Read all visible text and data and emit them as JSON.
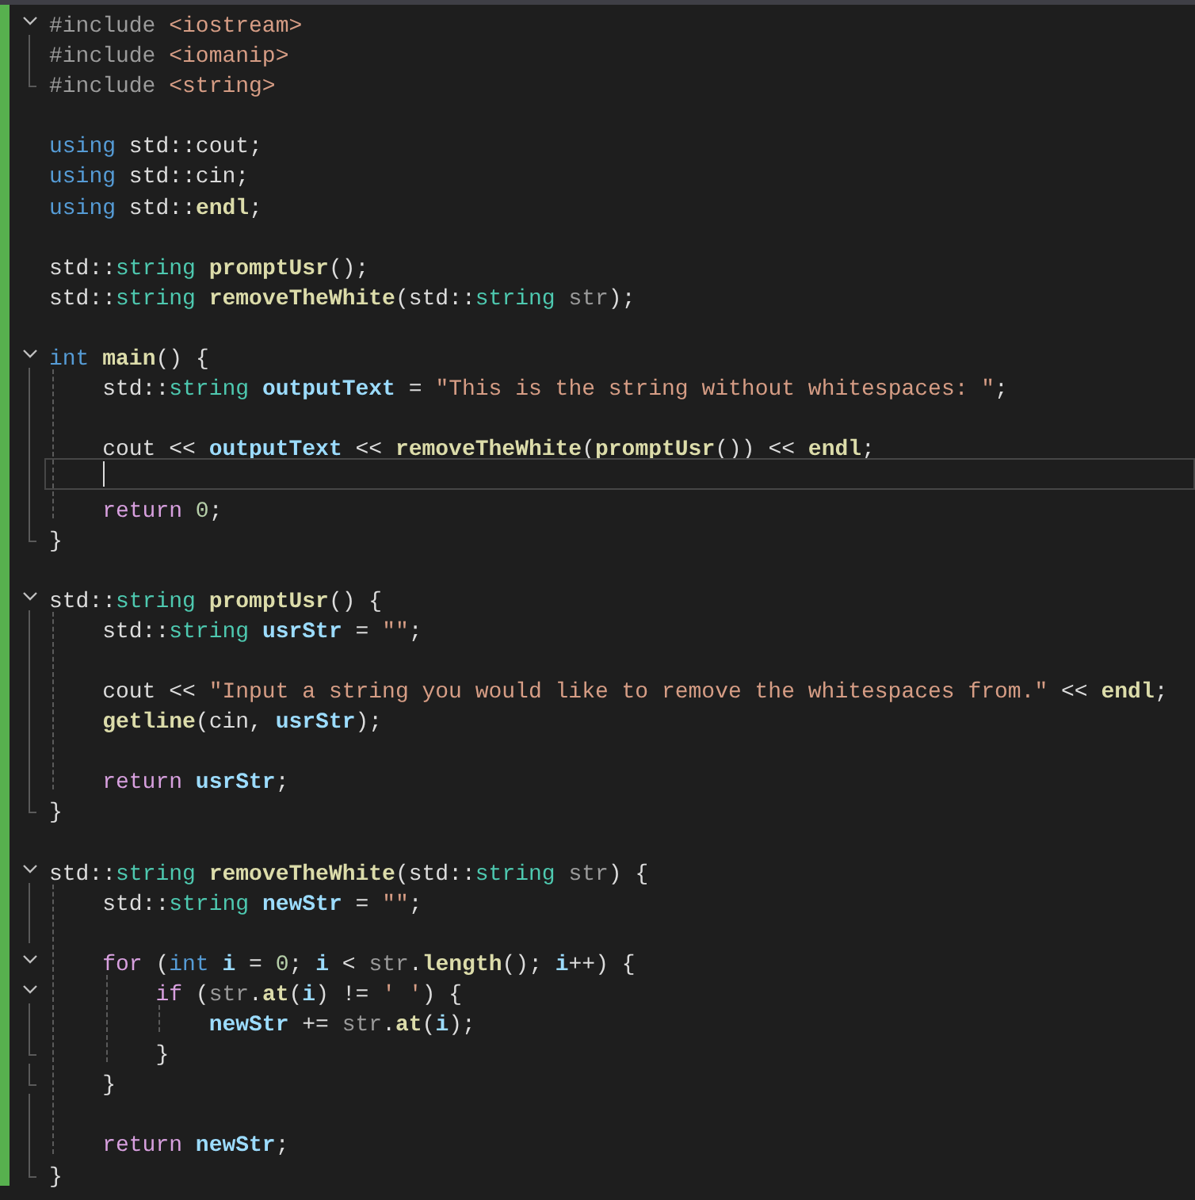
{
  "editor": {
    "lines": [
      {
        "kind": "code",
        "expanded": true,
        "tokens": [
          {
            "kind": "pre",
            "text": "#include"
          },
          {
            "kind": "str",
            "text": " <iostream>"
          }
        ]
      },
      {
        "kind": "code",
        "tokens": [
          {
            "kind": "pre",
            "text": "#include"
          },
          {
            "kind": "str",
            "text": " <iomanip>"
          }
        ]
      },
      {
        "kind": "code",
        "tokens": [
          {
            "kind": "pre",
            "text": "#include"
          },
          {
            "kind": "str",
            "text": " <string>"
          }
        ]
      },
      {
        "kind": "blank"
      },
      {
        "kind": "code",
        "tokens": [
          {
            "kind": "kw",
            "text": "using"
          },
          {
            "kind": "op",
            "text": " std::cout;"
          }
        ]
      },
      {
        "kind": "code",
        "tokens": [
          {
            "kind": "kw",
            "text": "using"
          },
          {
            "kind": "op",
            "text": " std::cin;"
          }
        ]
      },
      {
        "kind": "code",
        "tokens": [
          {
            "kind": "kw",
            "text": "using"
          },
          {
            "kind": "op",
            "text": " std::"
          },
          {
            "kind": "fn",
            "text": "endl"
          },
          {
            "kind": "op",
            "text": ";"
          }
        ]
      },
      {
        "kind": "blank"
      },
      {
        "kind": "code",
        "tokens": [
          {
            "kind": "op",
            "text": "std::"
          },
          {
            "kind": "type",
            "text": "string"
          },
          {
            "kind": "fn",
            "text": " promptUsr"
          },
          {
            "kind": "op",
            "text": "();"
          }
        ]
      },
      {
        "kind": "code",
        "tokens": [
          {
            "kind": "op",
            "text": "std::"
          },
          {
            "kind": "type",
            "text": "string"
          },
          {
            "kind": "fn",
            "text": " removeTheWhite"
          },
          {
            "kind": "op",
            "text": "(std::"
          },
          {
            "kind": "type",
            "text": "string"
          },
          {
            "kind": "param",
            "text": " str"
          },
          {
            "kind": "op",
            "text": ");"
          }
        ]
      },
      {
        "kind": "blank"
      },
      {
        "kind": "code",
        "expanded": true,
        "tokens": [
          {
            "kind": "kw",
            "text": "int"
          },
          {
            "kind": "fn",
            "text": " main"
          },
          {
            "kind": "op",
            "text": "() {"
          }
        ]
      },
      {
        "kind": "code",
        "tokens": [
          {
            "kind": "op",
            "text": "    std::"
          },
          {
            "kind": "type",
            "text": "string"
          },
          {
            "kind": "var",
            "text": " outputText"
          },
          {
            "kind": "op",
            "text": " = "
          },
          {
            "kind": "str",
            "text": "\"This is the string without whitespaces: \""
          },
          {
            "kind": "op",
            "text": ";"
          }
        ]
      },
      {
        "kind": "blank"
      },
      {
        "kind": "code",
        "tokens": [
          {
            "kind": "op",
            "text": "    cout << "
          },
          {
            "kind": "var",
            "text": "outputText"
          },
          {
            "kind": "op",
            "text": " << "
          },
          {
            "kind": "fn",
            "text": "removeTheWhite"
          },
          {
            "kind": "op",
            "text": "("
          },
          {
            "kind": "fn",
            "text": "promptUsr"
          },
          {
            "kind": "op",
            "text": "()) << "
          },
          {
            "kind": "fn",
            "text": "endl"
          },
          {
            "kind": "op",
            "text": ";"
          }
        ]
      },
      {
        "kind": "blank",
        "current": true
      },
      {
        "kind": "code",
        "tokens": [
          {
            "kind": "ctl",
            "text": "    return"
          },
          {
            "kind": "num",
            "text": " 0"
          },
          {
            "kind": "op",
            "text": ";"
          }
        ]
      },
      {
        "kind": "code",
        "tokens": [
          {
            "kind": "op",
            "text": "}"
          }
        ]
      },
      {
        "kind": "blank"
      },
      {
        "kind": "code",
        "expanded": true,
        "tokens": [
          {
            "kind": "op",
            "text": "std::"
          },
          {
            "kind": "type",
            "text": "string"
          },
          {
            "kind": "fn",
            "text": " promptUsr"
          },
          {
            "kind": "op",
            "text": "() {"
          }
        ]
      },
      {
        "kind": "code",
        "tokens": [
          {
            "kind": "op",
            "text": "    std::"
          },
          {
            "kind": "type",
            "text": "string"
          },
          {
            "kind": "var",
            "text": " usrStr"
          },
          {
            "kind": "op",
            "text": " = "
          },
          {
            "kind": "str",
            "text": "\"\""
          },
          {
            "kind": "op",
            "text": ";"
          }
        ]
      },
      {
        "kind": "blank"
      },
      {
        "kind": "code",
        "tokens": [
          {
            "kind": "op",
            "text": "    cout << "
          },
          {
            "kind": "str",
            "text": "\"Input a string you would like to remove the whitespaces from.\""
          },
          {
            "kind": "op",
            "text": " << "
          },
          {
            "kind": "fn",
            "text": "endl"
          },
          {
            "kind": "op",
            "text": ";"
          }
        ]
      },
      {
        "kind": "code",
        "tokens": [
          {
            "kind": "fn",
            "text": "    getline"
          },
          {
            "kind": "op",
            "text": "(cin, "
          },
          {
            "kind": "var",
            "text": "usrStr"
          },
          {
            "kind": "op",
            "text": ");"
          }
        ]
      },
      {
        "kind": "blank"
      },
      {
        "kind": "code",
        "tokens": [
          {
            "kind": "ctl",
            "text": "    return"
          },
          {
            "kind": "var",
            "text": " usrStr"
          },
          {
            "kind": "op",
            "text": ";"
          }
        ]
      },
      {
        "kind": "code",
        "tokens": [
          {
            "kind": "op",
            "text": "}"
          }
        ]
      },
      {
        "kind": "blank"
      },
      {
        "kind": "code",
        "expanded": true,
        "tokens": [
          {
            "kind": "op",
            "text": "std::"
          },
          {
            "kind": "type",
            "text": "string"
          },
          {
            "kind": "fn",
            "text": " removeTheWhite"
          },
          {
            "kind": "op",
            "text": "(std::"
          },
          {
            "kind": "type",
            "text": "string"
          },
          {
            "kind": "param",
            "text": " str"
          },
          {
            "kind": "op",
            "text": ") {"
          }
        ]
      },
      {
        "kind": "code",
        "tokens": [
          {
            "kind": "op",
            "text": "    std::"
          },
          {
            "kind": "type",
            "text": "string"
          },
          {
            "kind": "var",
            "text": " newStr"
          },
          {
            "kind": "op",
            "text": " = "
          },
          {
            "kind": "str",
            "text": "\"\""
          },
          {
            "kind": "op",
            "text": ";"
          }
        ]
      },
      {
        "kind": "blank"
      },
      {
        "kind": "code",
        "expanded": true,
        "tokens": [
          {
            "kind": "ctl",
            "text": "    for"
          },
          {
            "kind": "op",
            "text": " ("
          },
          {
            "kind": "kw",
            "text": "int"
          },
          {
            "kind": "var",
            "text": " i"
          },
          {
            "kind": "op",
            "text": " = "
          },
          {
            "kind": "num",
            "text": "0"
          },
          {
            "kind": "op",
            "text": "; "
          },
          {
            "kind": "var",
            "text": "i"
          },
          {
            "kind": "op",
            "text": " < "
          },
          {
            "kind": "param",
            "text": "str"
          },
          {
            "kind": "op",
            "text": "."
          },
          {
            "kind": "fn",
            "text": "length"
          },
          {
            "kind": "op",
            "text": "(); "
          },
          {
            "kind": "var",
            "text": "i"
          },
          {
            "kind": "op",
            "text": "++) {"
          }
        ]
      },
      {
        "kind": "code",
        "expanded": true,
        "tokens": [
          {
            "kind": "ctl",
            "text": "        if"
          },
          {
            "kind": "op",
            "text": " ("
          },
          {
            "kind": "param",
            "text": "str"
          },
          {
            "kind": "op",
            "text": "."
          },
          {
            "kind": "fn",
            "text": "at"
          },
          {
            "kind": "op",
            "text": "("
          },
          {
            "kind": "var",
            "text": "i"
          },
          {
            "kind": "op",
            "text": ") != "
          },
          {
            "kind": "str",
            "text": "' '"
          },
          {
            "kind": "op",
            "text": ") {"
          }
        ]
      },
      {
        "kind": "code",
        "tokens": [
          {
            "kind": "var",
            "text": "            newStr"
          },
          {
            "kind": "op",
            "text": " += "
          },
          {
            "kind": "param",
            "text": "str"
          },
          {
            "kind": "op",
            "text": "."
          },
          {
            "kind": "fn",
            "text": "at"
          },
          {
            "kind": "op",
            "text": "("
          },
          {
            "kind": "var",
            "text": "i"
          },
          {
            "kind": "op",
            "text": ");"
          }
        ]
      },
      {
        "kind": "code",
        "tokens": [
          {
            "kind": "op",
            "text": "        }"
          }
        ]
      },
      {
        "kind": "code",
        "tokens": [
          {
            "kind": "op",
            "text": "    }"
          }
        ]
      },
      {
        "kind": "blank"
      },
      {
        "kind": "code",
        "tokens": [
          {
            "kind": "ctl",
            "text": "    return"
          },
          {
            "kind": "var",
            "text": " newStr"
          },
          {
            "kind": "op",
            "text": ";"
          }
        ]
      },
      {
        "kind": "code",
        "tokens": [
          {
            "kind": "op",
            "text": "}"
          }
        ]
      }
    ]
  }
}
